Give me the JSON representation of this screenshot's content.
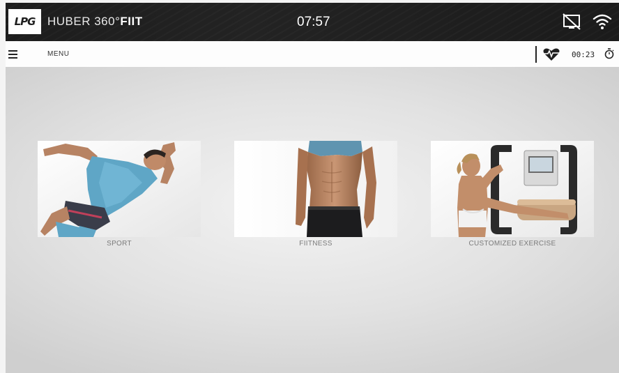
{
  "statusbar": {
    "logo": "LPG",
    "brand_prefix": "HUBER 360°",
    "brand_suffix": "FIIT",
    "time": "07:57",
    "icons": [
      "screen-off-icon",
      "wifi-icon"
    ]
  },
  "menubar": {
    "label": "MENU",
    "icons": [
      "hamburger-menu-icon",
      "heart-rate-icon",
      "stopwatch-icon"
    ],
    "timer": "00:23"
  },
  "tiles": [
    {
      "label": "SPORT",
      "image": "sprinter-athlete"
    },
    {
      "label": "FIITNESS",
      "image": "fitness-torso"
    },
    {
      "label": "CUSTOMIZED EXERCISE",
      "image": "woman-using-huber-machine"
    }
  ],
  "colors": {
    "topbar": "#1d1d1d",
    "menubar": "#fdfdfd",
    "background": "#e2e2e2",
    "label": "#7a7a7a"
  }
}
